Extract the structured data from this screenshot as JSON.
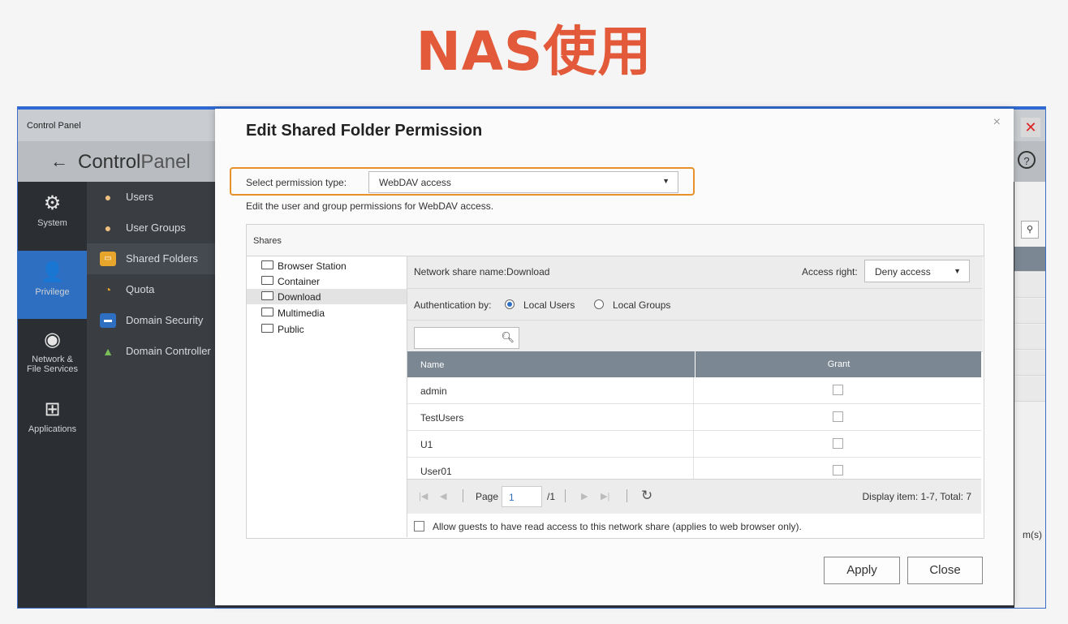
{
  "slide": {
    "title": "NAS使用"
  },
  "control_panel": {
    "window_title": "Control Panel",
    "header_back": "←",
    "header_title_a": "Control",
    "header_title_b": "Panel",
    "close_glyph": "✕",
    "rail": [
      {
        "label": "System",
        "icon": "⚙"
      },
      {
        "label": "Privilege",
        "icon": "👤"
      },
      {
        "label": "Network &",
        "label2": "File Services",
        "icon": "◉"
      },
      {
        "label": "Applications",
        "icon": "⊞"
      }
    ],
    "submenu": [
      {
        "label": "Users",
        "icon": "user-icon"
      },
      {
        "label": "User Groups",
        "icon": "user-group-icon"
      },
      {
        "label": "Shared Folders",
        "icon": "shared-folder-icon"
      },
      {
        "label": "Quota",
        "icon": "quota-icon"
      },
      {
        "label": "Domain Security",
        "icon": "domain-security-icon"
      },
      {
        "label": "Domain Controller",
        "icon": "domain-controller-icon"
      }
    ],
    "right_edge_text": "m(s)"
  },
  "dialog": {
    "title": "Edit Shared Folder Permission",
    "permission_type_label": "Select permission type:",
    "permission_type_value": "WebDAV access",
    "description": "Edit the user and group permissions for WebDAV access.",
    "shares_header": "Shares",
    "shares": [
      "Browser Station",
      "Container",
      "Download",
      "Multimedia",
      "Public"
    ],
    "selected_share": "Download",
    "network_share_name": "Network share name:Download",
    "access_right_label": "Access right:",
    "access_right_value": "Deny access",
    "auth_label": "Authentication by:",
    "auth_local_users": "Local Users",
    "auth_local_groups": "Local Groups",
    "table_headers": {
      "name": "Name",
      "grant": "Grant"
    },
    "rows": [
      {
        "name": "admin",
        "grant": false
      },
      {
        "name": "TestUsers",
        "grant": false
      },
      {
        "name": "U1",
        "grant": false
      },
      {
        "name": "User01",
        "grant": false
      }
    ],
    "pager": {
      "page_label": "Page",
      "page_value": "1",
      "total_pages": "/1",
      "display": "Display item: 1-7, Total: 7"
    },
    "guest_access": "Allow guests to have read access to this network share (applies to web browser only).",
    "apply_label": "Apply",
    "close_label": "Close",
    "close_glyph": "×"
  },
  "colors": {
    "accent": "#2f6fc1",
    "highlight_border": "#e8902a",
    "title_red": "#e25a3a"
  }
}
